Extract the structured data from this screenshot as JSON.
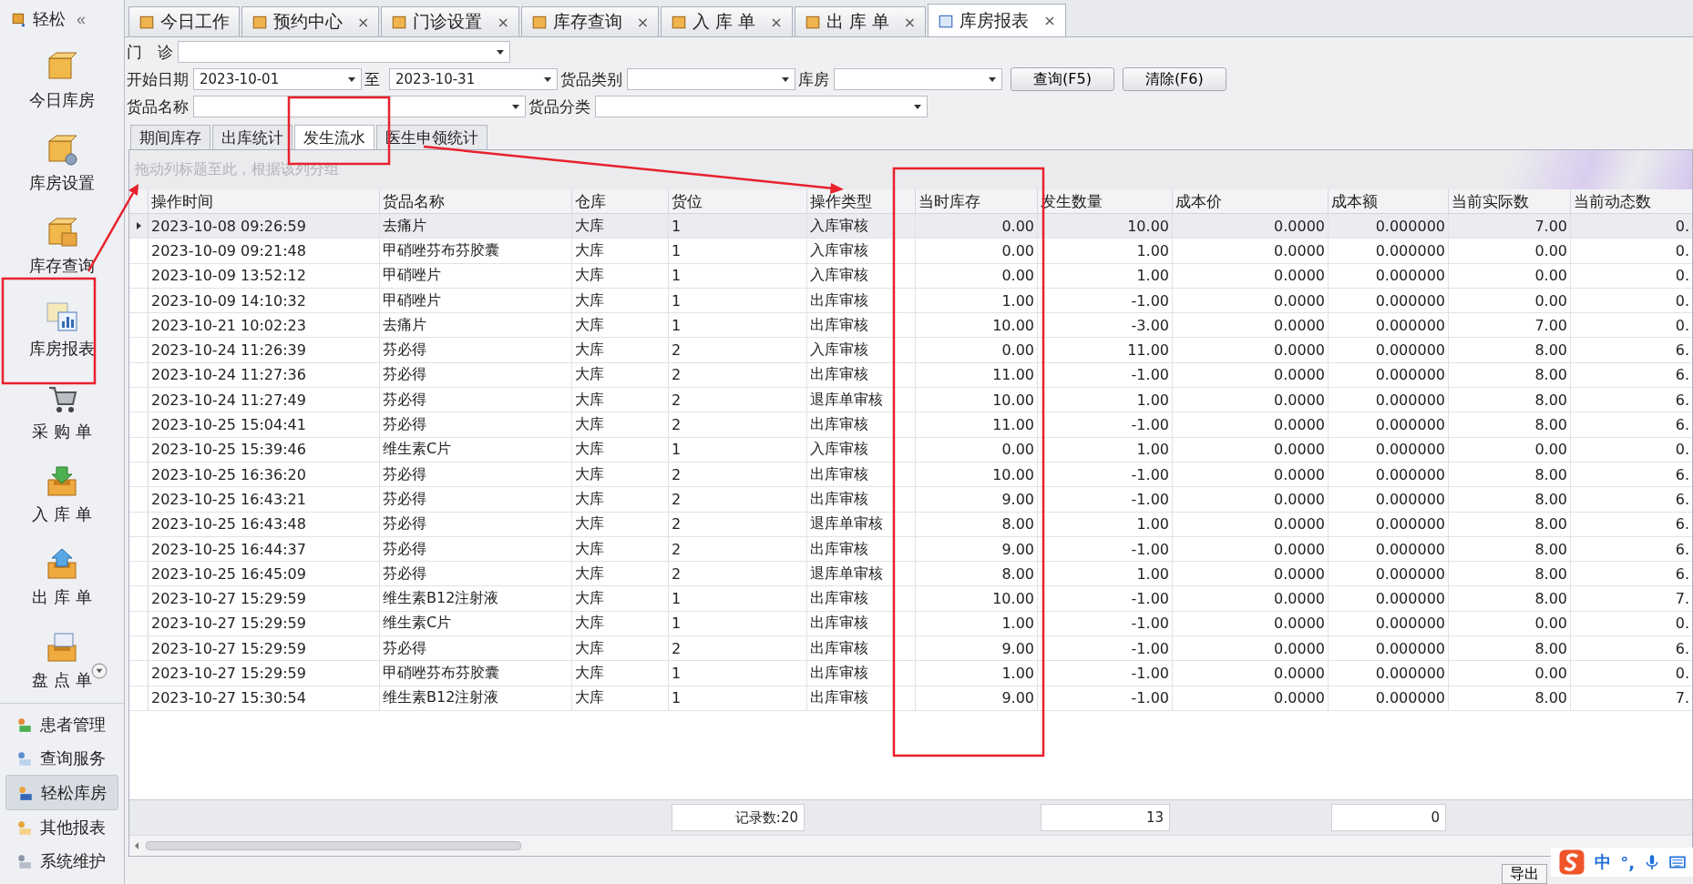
{
  "sidebar": {
    "title": "轻松",
    "collapse_glyph": "«",
    "items": [
      {
        "label": "今日库房",
        "selected": false
      },
      {
        "label": "库房设置",
        "selected": false
      },
      {
        "label": "库存查询",
        "selected": false
      },
      {
        "label": "库房报表",
        "selected": false
      },
      {
        "label": "采 购 单",
        "selected": false
      },
      {
        "label": "入 库 单",
        "selected": false
      },
      {
        "label": "出 库 单",
        "selected": false
      },
      {
        "label": "盘 点 单",
        "selected": false
      }
    ],
    "groups": [
      {
        "label": "患者管理",
        "selected": false
      },
      {
        "label": "查询服务",
        "selected": false
      },
      {
        "label": "轻松库房",
        "selected": true
      },
      {
        "label": "其他报表",
        "selected": false
      },
      {
        "label": "系统维护",
        "selected": false
      }
    ]
  },
  "tabs": [
    {
      "label": "今日工作",
      "selected": false
    },
    {
      "label": "预约中心",
      "selected": false,
      "close": "×"
    },
    {
      "label": "门诊设置",
      "selected": false,
      "close": "×"
    },
    {
      "label": "库存查询",
      "selected": false,
      "close": "×"
    },
    {
      "label": "入 库 单",
      "selected": false,
      "close": "×"
    },
    {
      "label": "出 库 单",
      "selected": false,
      "close": "×"
    },
    {
      "label": "库房报表",
      "selected": true,
      "close": "×"
    }
  ],
  "filter_rows": [
    [
      {
        "kind": "label",
        "text": "门　诊"
      },
      {
        "kind": "long_combo"
      }
    ],
    [
      {
        "kind": "label",
        "text": "开始日期"
      },
      {
        "kind": "date",
        "value": "2023-10-01"
      },
      {
        "kind": "label",
        "text": "至"
      },
      {
        "kind": "date",
        "value": "2023-10-31"
      },
      {
        "kind": "label",
        "text": "货品类别"
      },
      {
        "kind": "combo"
      },
      {
        "kind": "label",
        "text": "库房"
      },
      {
        "kind": "combo"
      },
      {
        "kind": "button",
        "text": "查询(F5)"
      },
      {
        "kind": "button",
        "text": "清除(F6)"
      }
    ],
    [
      {
        "kind": "label",
        "text": "货品名称"
      },
      {
        "kind": "long_combo"
      },
      {
        "kind": "label",
        "text": "货品分类"
      },
      {
        "kind": "long_combo"
      }
    ]
  ],
  "report_tabs": [
    {
      "label": "期间库存",
      "selected": false
    },
    {
      "label": "出库统计",
      "selected": false
    },
    {
      "label": "发生流水",
      "selected": true
    },
    {
      "label": "医生申领统计",
      "selected": false
    }
  ],
  "group_panel_hint": "拖动列标题至此，根据该列分组",
  "table": {
    "columns": [
      "操作时间",
      "货品名称",
      "仓库",
      "货位",
      "操作类型",
      "当时库存",
      "发生数量",
      "成本价",
      "成本额",
      "当前实际数",
      "当前动态数"
    ],
    "rows": [
      {
        "selected": true,
        "cells": [
          "2023-10-08 09:26:59",
          "去痛片",
          "大库",
          "1",
          "入库审核",
          "0.00",
          "10.00",
          "0.0000",
          "0.000000",
          "7.00",
          "0."
        ]
      },
      {
        "selected": false,
        "cells": [
          "2023-10-09 09:21:48",
          "甲硝唑芬布芬胶囊",
          "大库",
          "1",
          "入库审核",
          "0.00",
          "1.00",
          "0.0000",
          "0.000000",
          "0.00",
          "0."
        ]
      },
      {
        "selected": false,
        "cells": [
          "2023-10-09 13:52:12",
          "甲硝唑片",
          "大库",
          "1",
          "入库审核",
          "0.00",
          "1.00",
          "0.0000",
          "0.000000",
          "0.00",
          "0."
        ]
      },
      {
        "selected": false,
        "cells": [
          "2023-10-09 14:10:32",
          "甲硝唑片",
          "大库",
          "1",
          "出库审核",
          "1.00",
          "-1.00",
          "0.0000",
          "0.000000",
          "0.00",
          "0."
        ]
      },
      {
        "selected": false,
        "cells": [
          "2023-10-21 10:02:23",
          "去痛片",
          "大库",
          "1",
          "出库审核",
          "10.00",
          "-3.00",
          "0.0000",
          "0.000000",
          "7.00",
          "0."
        ]
      },
      {
        "selected": false,
        "cells": [
          "2023-10-24 11:26:39",
          "芬必得",
          "大库",
          "2",
          "入库审核",
          "0.00",
          "11.00",
          "0.0000",
          "0.000000",
          "8.00",
          "6."
        ]
      },
      {
        "selected": false,
        "cells": [
          "2023-10-24 11:27:36",
          "芬必得",
          "大库",
          "2",
          "出库审核",
          "11.00",
          "-1.00",
          "0.0000",
          "0.000000",
          "8.00",
          "6."
        ]
      },
      {
        "selected": false,
        "cells": [
          "2023-10-24 11:27:49",
          "芬必得",
          "大库",
          "2",
          "退库单审核",
          "10.00",
          "1.00",
          "0.0000",
          "0.000000",
          "8.00",
          "6."
        ]
      },
      {
        "selected": false,
        "cells": [
          "2023-10-25 15:04:41",
          "芬必得",
          "大库",
          "2",
          "出库审核",
          "11.00",
          "-1.00",
          "0.0000",
          "0.000000",
          "8.00",
          "6."
        ]
      },
      {
        "selected": false,
        "cells": [
          "2023-10-25 15:39:46",
          "维生素C片",
          "大库",
          "1",
          "入库审核",
          "0.00",
          "1.00",
          "0.0000",
          "0.000000",
          "0.00",
          "0."
        ]
      },
      {
        "selected": false,
        "cells": [
          "2023-10-25 16:36:20",
          "芬必得",
          "大库",
          "2",
          "出库审核",
          "10.00",
          "-1.00",
          "0.0000",
          "0.000000",
          "8.00",
          "6."
        ]
      },
      {
        "selected": false,
        "cells": [
          "2023-10-25 16:43:21",
          "芬必得",
          "大库",
          "2",
          "出库审核",
          "9.00",
          "-1.00",
          "0.0000",
          "0.000000",
          "8.00",
          "6."
        ]
      },
      {
        "selected": false,
        "cells": [
          "2023-10-25 16:43:48",
          "芬必得",
          "大库",
          "2",
          "退库单审核",
          "8.00",
          "1.00",
          "0.0000",
          "0.000000",
          "8.00",
          "6."
        ]
      },
      {
        "selected": false,
        "cells": [
          "2023-10-25 16:44:37",
          "芬必得",
          "大库",
          "2",
          "出库审核",
          "9.00",
          "-1.00",
          "0.0000",
          "0.000000",
          "8.00",
          "6."
        ]
      },
      {
        "selected": false,
        "cells": [
          "2023-10-25 16:45:09",
          "芬必得",
          "大库",
          "2",
          "退库单审核",
          "8.00",
          "1.00",
          "0.0000",
          "0.000000",
          "8.00",
          "6."
        ]
      },
      {
        "selected": false,
        "cells": [
          "2023-10-27 15:29:59",
          "维生素B12注射液",
          "大库",
          "1",
          "出库审核",
          "10.00",
          "-1.00",
          "0.0000",
          "0.000000",
          "8.00",
          "7."
        ]
      },
      {
        "selected": false,
        "cells": [
          "2023-10-27 15:29:59",
          "维生素C片",
          "大库",
          "1",
          "出库审核",
          "1.00",
          "-1.00",
          "0.0000",
          "0.000000",
          "0.00",
          "0."
        ]
      },
      {
        "selected": false,
        "cells": [
          "2023-10-27 15:29:59",
          "芬必得",
          "大库",
          "2",
          "出库审核",
          "9.00",
          "-1.00",
          "0.0000",
          "0.000000",
          "8.00",
          "6."
        ]
      },
      {
        "selected": false,
        "cells": [
          "2023-10-27 15:29:59",
          "甲硝唑芬布芬胶囊",
          "大库",
          "1",
          "出库审核",
          "1.00",
          "-1.00",
          "0.0000",
          "0.000000",
          "0.00",
          "0."
        ]
      },
      {
        "selected": false,
        "cells": [
          "2023-10-27 15:30:54",
          "维生素B12注射液",
          "大库",
          "1",
          "出库审核",
          "9.00",
          "-1.00",
          "0.0000",
          "0.000000",
          "8.00",
          "7."
        ]
      }
    ],
    "footer": [
      "记录数:20",
      "13",
      "0"
    ]
  },
  "status_bar": {
    "export_button": "导出",
    "ime_mode": "中",
    "ime_punct": "°,"
  }
}
